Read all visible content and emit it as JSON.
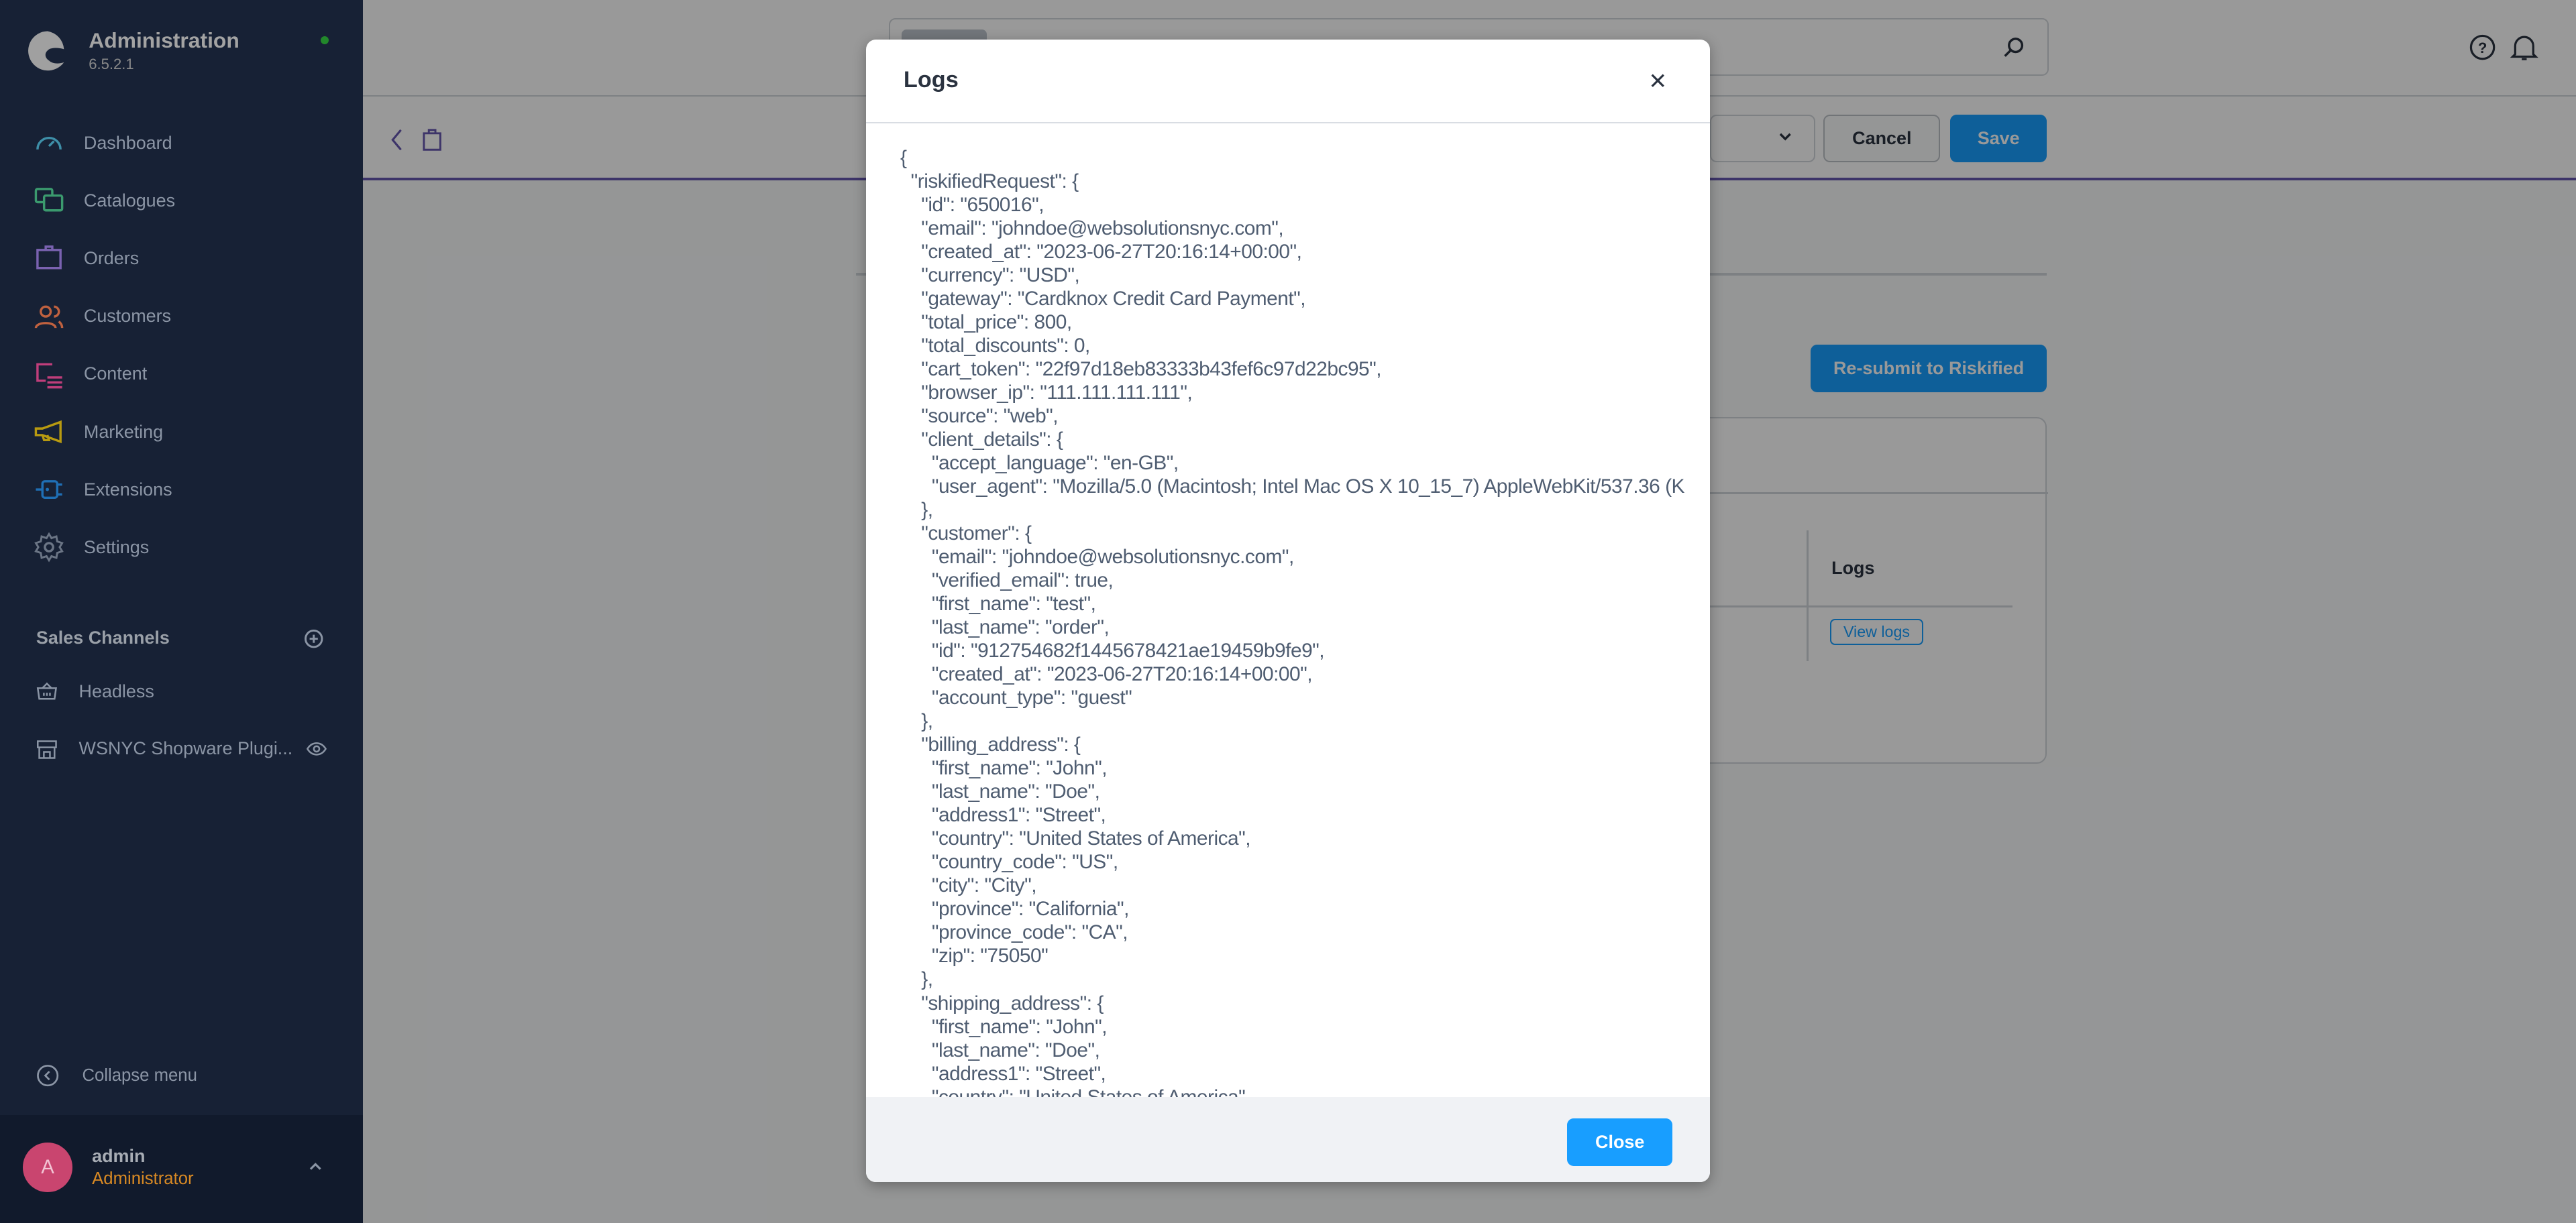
{
  "sidebar": {
    "title": "Administration",
    "version": "6.5.2.1",
    "status_color": "#2eb82e",
    "items": [
      {
        "label": "Dashboard",
        "icon": "dashboard-icon",
        "color": "#3e8fa8"
      },
      {
        "label": "Catalogues",
        "icon": "catalogues-icon",
        "color": "#3b9a6e"
      },
      {
        "label": "Orders",
        "icon": "orders-icon",
        "color": "#7a62b0"
      },
      {
        "label": "Customers",
        "icon": "customers-icon",
        "color": "#c0613f"
      },
      {
        "label": "Content",
        "icon": "content-icon",
        "color": "#c03e7b"
      },
      {
        "label": "Marketing",
        "icon": "marketing-icon",
        "color": "#b89a10"
      },
      {
        "label": "Extensions",
        "icon": "extensions-icon",
        "color": "#1f6fb5"
      },
      {
        "label": "Settings",
        "icon": "settings-icon",
        "color": "#6b7585"
      }
    ],
    "sales_channels_title": "Sales Channels",
    "sales_channels": [
      {
        "label": "Headless"
      },
      {
        "label": "WSNYC Shopware Plugi..."
      }
    ],
    "collapse_label": "Collapse menu",
    "user": {
      "initial": "A",
      "name": "admin",
      "role": "Administrator"
    }
  },
  "toolbar": {
    "cancel_label": "Cancel",
    "save_label": "Save"
  },
  "main": {
    "resubmit_label": "Re-submit to Riskified",
    "table": {
      "column_logs": "Logs",
      "view_logs_label": "View logs"
    }
  },
  "modal": {
    "title": "Logs",
    "close_label": "Close",
    "json_lines": [
      "{",
      "  \"riskifiedRequest\": {",
      "    \"id\": \"650016\",",
      "    \"email\": \"johndoe@websolutionsnyc.com\",",
      "    \"created_at\": \"2023-06-27T20:16:14+00:00\",",
      "    \"currency\": \"USD\",",
      "    \"gateway\": \"Cardknox Credit Card Payment\",",
      "    \"total_price\": 800,",
      "    \"total_discounts\": 0,",
      "    \"cart_token\": \"22f97d18eb83333b43fef6c97d22bc95\",",
      "    \"browser_ip\": \"111.111.111.111\",",
      "    \"source\": \"web\",",
      "    \"client_details\": {",
      "      \"accept_language\": \"en-GB\",",
      "      \"user_agent\": \"Mozilla/5.0 (Macintosh; Intel Mac OS X 10_15_7) AppleWebKit/537.36 (K",
      "    },",
      "    \"customer\": {",
      "      \"email\": \"johndoe@websolutionsnyc.com\",",
      "      \"verified_email\": true,",
      "      \"first_name\": \"test\",",
      "      \"last_name\": \"order\",",
      "      \"id\": \"912754682f1445678421ae19459b9fe9\",",
      "      \"created_at\": \"2023-06-27T20:16:14+00:00\",",
      "      \"account_type\": \"guest\"",
      "    },",
      "    \"billing_address\": {",
      "      \"first_name\": \"John\",",
      "      \"last_name\": \"Doe\",",
      "      \"address1\": \"Street\",",
      "      \"country\": \"United States of America\",",
      "      \"country_code\": \"US\",",
      "      \"city\": \"City\",",
      "      \"province\": \"California\",",
      "      \"province_code\": \"CA\",",
      "      \"zip\": \"75050\"",
      "    },",
      "    \"shipping_address\": {",
      "      \"first_name\": \"John\",",
      "      \"last_name\": \"Doe\",",
      "      \"address1\": \"Street\",",
      "      \"country\": \"United States of America\","
    ]
  },
  "colors": {
    "primary": "#189eff",
    "sidebar_bg": "#172135",
    "accent_purple": "#6758b0",
    "user_role": "#e0932a",
    "avatar": "#c9456f"
  }
}
